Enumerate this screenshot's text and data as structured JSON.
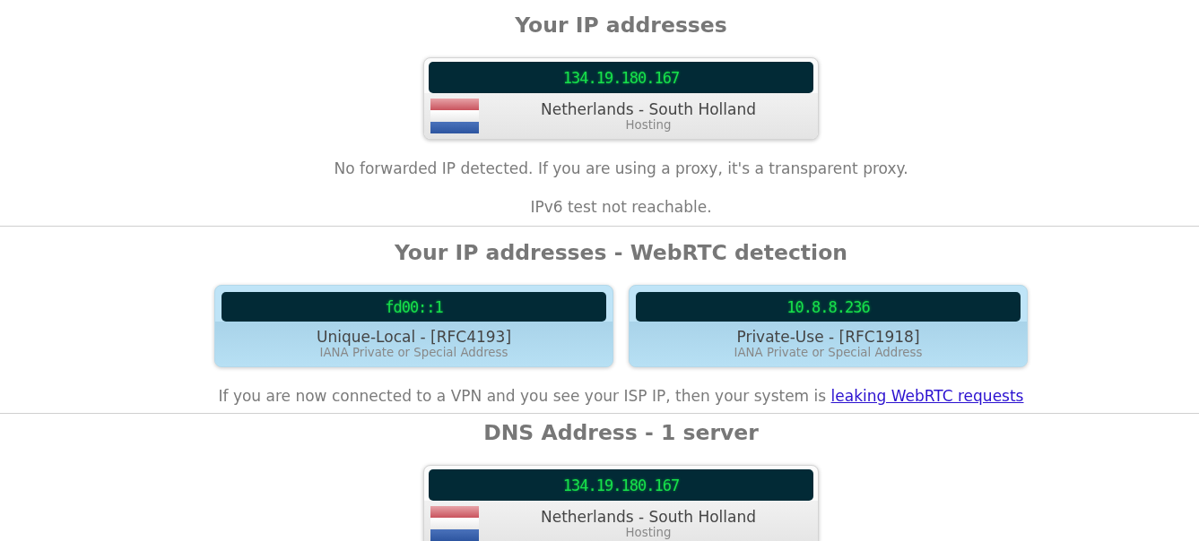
{
  "sections": [
    {
      "title": "Your IP addresses",
      "cards": [
        {
          "kind": "geo",
          "ip": "134.19.180.167",
          "location": "Netherlands - South Holland",
          "detail": "Hosting"
        }
      ],
      "notes": [
        {
          "text": "No forwarded IP detected. If you are using a proxy, it's a transparent proxy."
        },
        {
          "text": "IPv6 test not reachable."
        }
      ]
    },
    {
      "title": "Your IP addresses - WebRTC detection",
      "cards": [
        {
          "kind": "local",
          "ip": "fd00::1",
          "location": "Unique-Local - [RFC4193]",
          "detail": "IANA Private or Special Address"
        },
        {
          "kind": "local",
          "ip": "10.8.8.236",
          "location": "Private-Use - [RFC1918]",
          "detail": "IANA Private or Special Address"
        }
      ],
      "notes": [
        {
          "text": "If you are now connected to a VPN and you see your ISP IP, then your system is",
          "link": "leaking WebRTC requests"
        }
      ]
    },
    {
      "title": "DNS Address - 1 server",
      "cards": [
        {
          "kind": "geo",
          "ip": "134.19.180.167",
          "location": "Netherlands - South Holland",
          "detail": "Hosting"
        }
      ]
    }
  ]
}
